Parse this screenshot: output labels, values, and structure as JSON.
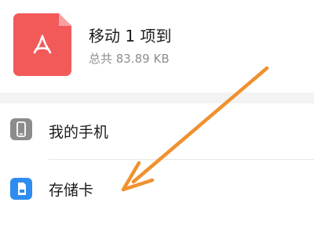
{
  "file": {
    "title": "移动 1 项到",
    "size": "总共 83.89 KB",
    "icon": "pdf-file-icon"
  },
  "locations": [
    {
      "label": "我的手机",
      "icon": "phone-icon"
    },
    {
      "label": "存储卡",
      "icon": "sd-card-icon"
    }
  ],
  "colors": {
    "pdf_icon": "#f25a5a",
    "phone_icon": "#8c8c8c",
    "sdcard_icon": "#2f8cf0",
    "annotation_arrow": "#f0912f"
  },
  "annotation": {
    "type": "arrow",
    "points_to": "存储卡"
  }
}
